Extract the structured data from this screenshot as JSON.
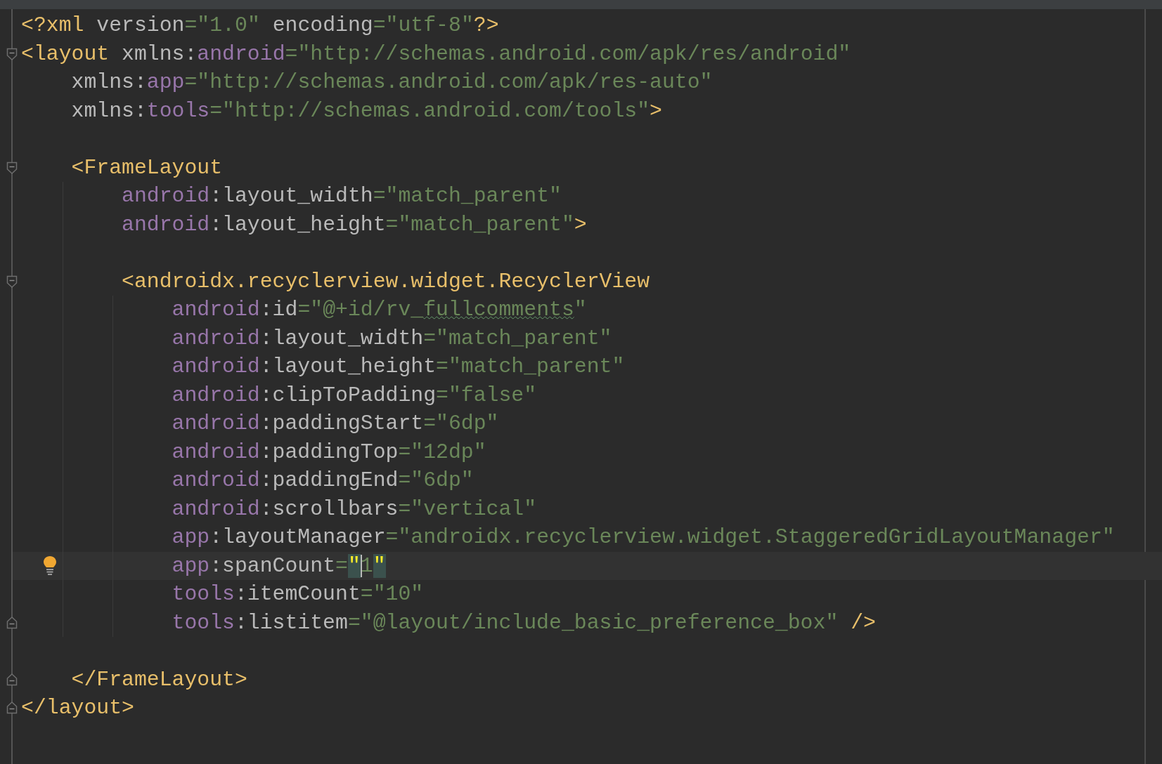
{
  "editor": {
    "lines": [
      {
        "current": false,
        "tokens": [
          {
            "kind": "tag",
            "text": "<?xml"
          },
          {
            "kind": "plain",
            "text": " version"
          },
          {
            "kind": "eq",
            "text": "="
          },
          {
            "kind": "value",
            "text": "\"1.0\""
          },
          {
            "kind": "plain",
            "text": " encoding"
          },
          {
            "kind": "eq",
            "text": "="
          },
          {
            "kind": "value",
            "text": "\"utf-8\""
          },
          {
            "kind": "tag",
            "text": "?>"
          }
        ]
      },
      {
        "current": false,
        "fold_start": true,
        "tokens": [
          {
            "kind": "tag",
            "text": "<layout"
          },
          {
            "kind": "plain",
            "text": " xmlns:"
          },
          {
            "kind": "ns",
            "text": "android"
          },
          {
            "kind": "eq",
            "text": "="
          },
          {
            "kind": "value",
            "text": "\"http://schemas.android.com/apk/res/android\""
          }
        ],
        "children": [
          {
            "current": false,
            "tokens": [
              {
                "kind": "plain",
                "text": "xmlns:"
              },
              {
                "kind": "ns",
                "text": "app"
              },
              {
                "kind": "eq",
                "text": "="
              },
              {
                "kind": "value",
                "text": "\"http://schemas.android.com/apk/res-auto\""
              }
            ]
          },
          {
            "current": false,
            "tokens": [
              {
                "kind": "plain",
                "text": "xmlns:"
              },
              {
                "kind": "ns",
                "text": "tools"
              },
              {
                "kind": "eq",
                "text": "="
              },
              {
                "kind": "value",
                "text": "\"http://schemas.android.com/tools\""
              },
              {
                "kind": "tag",
                "text": ">"
              }
            ]
          },
          {
            "current": false
          },
          {
            "current": false,
            "fold_start": true,
            "tokens": [
              {
                "kind": "tag",
                "text": "<FrameLayout"
              }
            ],
            "children": [
              {
                "current": false,
                "tokens": [
                  {
                    "kind": "ns",
                    "text": "android"
                  },
                  {
                    "kind": "plain",
                    "text": ":layout_width"
                  },
                  {
                    "kind": "eq",
                    "text": "="
                  },
                  {
                    "kind": "value",
                    "text": "\"match_parent\""
                  }
                ]
              },
              {
                "current": false,
                "tokens": [
                  {
                    "kind": "ns",
                    "text": "android"
                  },
                  {
                    "kind": "plain",
                    "text": ":layout_height"
                  },
                  {
                    "kind": "eq",
                    "text": "="
                  },
                  {
                    "kind": "value",
                    "text": "\"match_parent\""
                  },
                  {
                    "kind": "tag",
                    "text": ">"
                  }
                ]
              },
              {
                "current": false
              },
              {
                "current": false,
                "fold_start": true,
                "tokens": [
                  {
                    "kind": "tag",
                    "text": "<androidx.recyclerview.widget.RecyclerView"
                  }
                ],
                "children": [
                  {
                    "current": false,
                    "tokens": [
                      {
                        "kind": "ns",
                        "text": "android"
                      },
                      {
                        "kind": "plain",
                        "text": ":id"
                      },
                      {
                        "kind": "eq",
                        "text": "="
                      },
                      {
                        "kind": "value",
                        "text": "\"@+id/rv_"
                      },
                      {
                        "kind": "typo",
                        "text": "fullcomments"
                      },
                      {
                        "kind": "value",
                        "text": "\""
                      }
                    ]
                  },
                  {
                    "current": false,
                    "tokens": [
                      {
                        "kind": "ns",
                        "text": "android"
                      },
                      {
                        "kind": "plain",
                        "text": ":layout_width"
                      },
                      {
                        "kind": "eq",
                        "text": "="
                      },
                      {
                        "kind": "value",
                        "text": "\"match_parent\""
                      }
                    ]
                  },
                  {
                    "current": false,
                    "tokens": [
                      {
                        "kind": "ns",
                        "text": "android"
                      },
                      {
                        "kind": "plain",
                        "text": ":layout_height"
                      },
                      {
                        "kind": "eq",
                        "text": "="
                      },
                      {
                        "kind": "value",
                        "text": "\"match_parent\""
                      }
                    ]
                  },
                  {
                    "current": false,
                    "tokens": [
                      {
                        "kind": "ns",
                        "text": "android"
                      },
                      {
                        "kind": "plain",
                        "text": ":clipToPadding"
                      },
                      {
                        "kind": "eq",
                        "text": "="
                      },
                      {
                        "kind": "value",
                        "text": "\"false\""
                      }
                    ]
                  },
                  {
                    "current": false,
                    "tokens": [
                      {
                        "kind": "ns",
                        "text": "android"
                      },
                      {
                        "kind": "plain",
                        "text": ":paddingStart"
                      },
                      {
                        "kind": "eq",
                        "text": "="
                      },
                      {
                        "kind": "value",
                        "text": "\"6dp\""
                      }
                    ]
                  },
                  {
                    "current": false,
                    "tokens": [
                      {
                        "kind": "ns",
                        "text": "android"
                      },
                      {
                        "kind": "plain",
                        "text": ":paddingTop"
                      },
                      {
                        "kind": "eq",
                        "text": "="
                      },
                      {
                        "kind": "value",
                        "text": "\"12dp\""
                      }
                    ]
                  },
                  {
                    "current": false,
                    "tokens": [
                      {
                        "kind": "ns",
                        "text": "android"
                      },
                      {
                        "kind": "plain",
                        "text": ":paddingEnd"
                      },
                      {
                        "kind": "eq",
                        "text": "="
                      },
                      {
                        "kind": "value",
                        "text": "\"6dp\""
                      }
                    ]
                  },
                  {
                    "current": false,
                    "tokens": [
                      {
                        "kind": "ns",
                        "text": "android"
                      },
                      {
                        "kind": "plain",
                        "text": ":scrollbars"
                      },
                      {
                        "kind": "eq",
                        "text": "="
                      },
                      {
                        "kind": "value",
                        "text": "\"vertical\""
                      }
                    ]
                  },
                  {
                    "current": false,
                    "tokens": [
                      {
                        "kind": "ns",
                        "text": "app"
                      },
                      {
                        "kind": "plain",
                        "text": ":layoutManager"
                      },
                      {
                        "kind": "eq",
                        "text": "="
                      },
                      {
                        "kind": "value",
                        "text": "\"androidx.recyclerview.widget.StaggeredGridLayoutManager\""
                      }
                    ]
                  },
                  {
                    "current": true,
                    "bulb": true,
                    "tokens": [
                      {
                        "kind": "ns",
                        "text": "app"
                      },
                      {
                        "kind": "plain",
                        "text": ":spanCount"
                      },
                      {
                        "kind": "eq",
                        "text": "="
                      },
                      {
                        "kind": "match",
                        "text": "\""
                      },
                      {
                        "kind": "value",
                        "text": "1",
                        "caret": true
                      },
                      {
                        "kind": "match",
                        "text": "\""
                      }
                    ]
                  },
                  {
                    "current": false,
                    "tokens": [
                      {
                        "kind": "ns",
                        "text": "tools"
                      },
                      {
                        "kind": "plain",
                        "text": ":itemCount"
                      },
                      {
                        "kind": "eq",
                        "text": "="
                      },
                      {
                        "kind": "value",
                        "text": "\"10\""
                      }
                    ]
                  },
                  {
                    "current": false,
                    "fold_end": true,
                    "tokens": [
                      {
                        "kind": "ns",
                        "text": "tools"
                      },
                      {
                        "kind": "plain",
                        "text": ":listitem"
                      },
                      {
                        "kind": "eq",
                        "text": "="
                      },
                      {
                        "kind": "value",
                        "text": "\"@layout/include_basic_preference_box\""
                      },
                      {
                        "kind": "tag",
                        "text": " />"
                      }
                    ]
                  }
                ]
              }
            ]
          },
          {
            "current": false
          },
          {
            "current": false,
            "fold_end": true,
            "tokens": [
              {
                "kind": "tag",
                "text": "</FrameLayout>"
              }
            ]
          }
        ]
      },
      {
        "current": false,
        "fold_end": true,
        "tokens": [
          {
            "kind": "tag",
            "text": "</layout>"
          }
        ]
      }
    ]
  }
}
